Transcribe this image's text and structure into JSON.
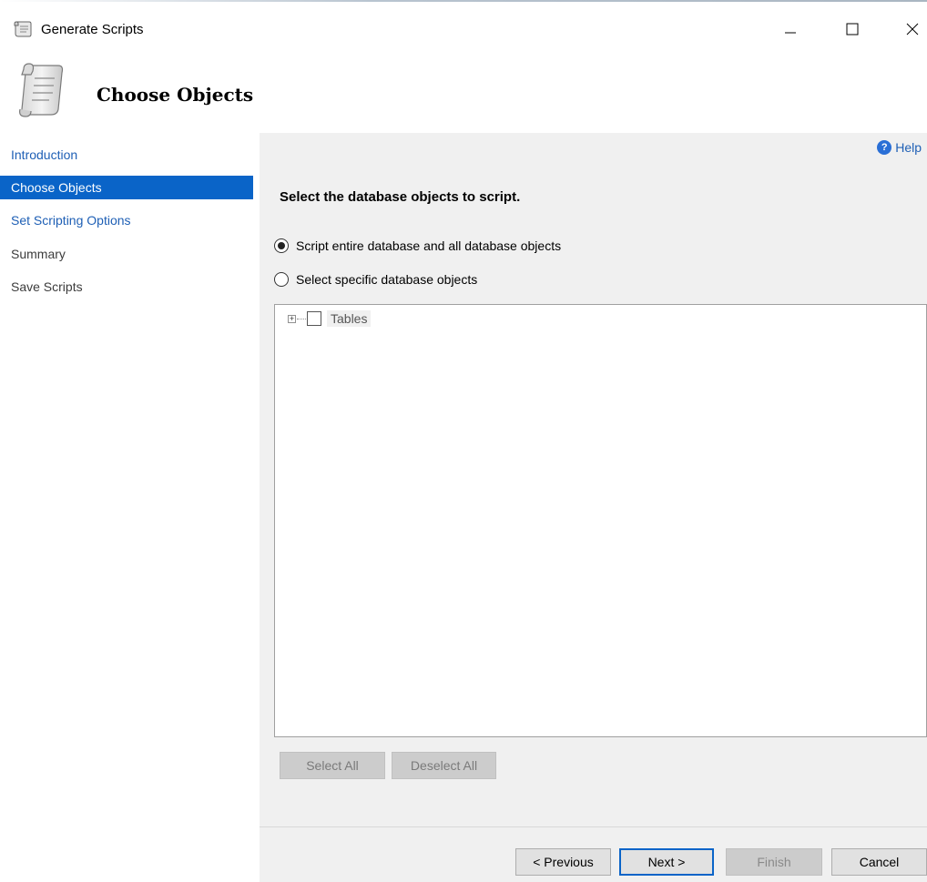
{
  "window": {
    "title": "Generate Scripts",
    "icons": {
      "app": "scroll-icon",
      "minimize": "minimize-icon",
      "maximize": "maximize-icon",
      "close": "close-icon"
    }
  },
  "header": {
    "title": "Choose Objects",
    "icon": "scroll-icon"
  },
  "sidebar": {
    "items": [
      {
        "label": "Introduction",
        "state": "link"
      },
      {
        "label": "Choose Objects",
        "state": "active"
      },
      {
        "label": "Set Scripting Options",
        "state": "link"
      },
      {
        "label": "Summary",
        "state": "disabled"
      },
      {
        "label": "Save Scripts",
        "state": "disabled"
      }
    ]
  },
  "content": {
    "help_label": "Help",
    "heading": "Select the database objects to script.",
    "options": [
      {
        "label": "Script entire database and all database objects",
        "selected": true
      },
      {
        "label": "Select specific database objects",
        "selected": false
      }
    ],
    "tree": {
      "items": [
        {
          "label": "Tables",
          "checked": false,
          "expanded": false
        }
      ]
    },
    "select_all_label": "Select All",
    "deselect_all_label": "Deselect All"
  },
  "footer": {
    "previous_label": "< Previous",
    "next_label": "Next >",
    "finish_label": "Finish",
    "cancel_label": "Cancel"
  },
  "colors": {
    "accent": "#0a64c8",
    "link": "#1e5fb5",
    "panel": "#f0f0f0"
  }
}
